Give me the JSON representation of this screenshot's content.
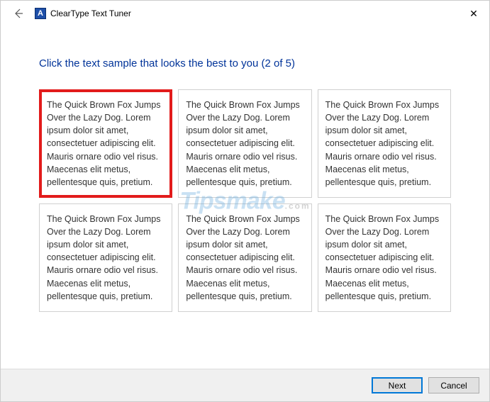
{
  "window": {
    "title": "ClearType Text Tuner",
    "app_icon_letter": "A"
  },
  "heading": "Click the text sample that looks the best to you (2 of 5)",
  "sample_text": "The Quick Brown Fox Jumps Over the Lazy Dog. Lorem ipsum dolor sit amet, consectetuer adipiscing elit. Mauris ornare odio vel risus. Maecenas elit metus, pellentesque quis, pretium.",
  "samples": [
    {
      "selected": true
    },
    {
      "selected": false
    },
    {
      "selected": false
    },
    {
      "selected": false
    },
    {
      "selected": false
    },
    {
      "selected": false
    }
  ],
  "footer": {
    "next": "Next",
    "cancel": "Cancel"
  },
  "watermark": {
    "main": "Tipsmake",
    "sub": ".com"
  }
}
